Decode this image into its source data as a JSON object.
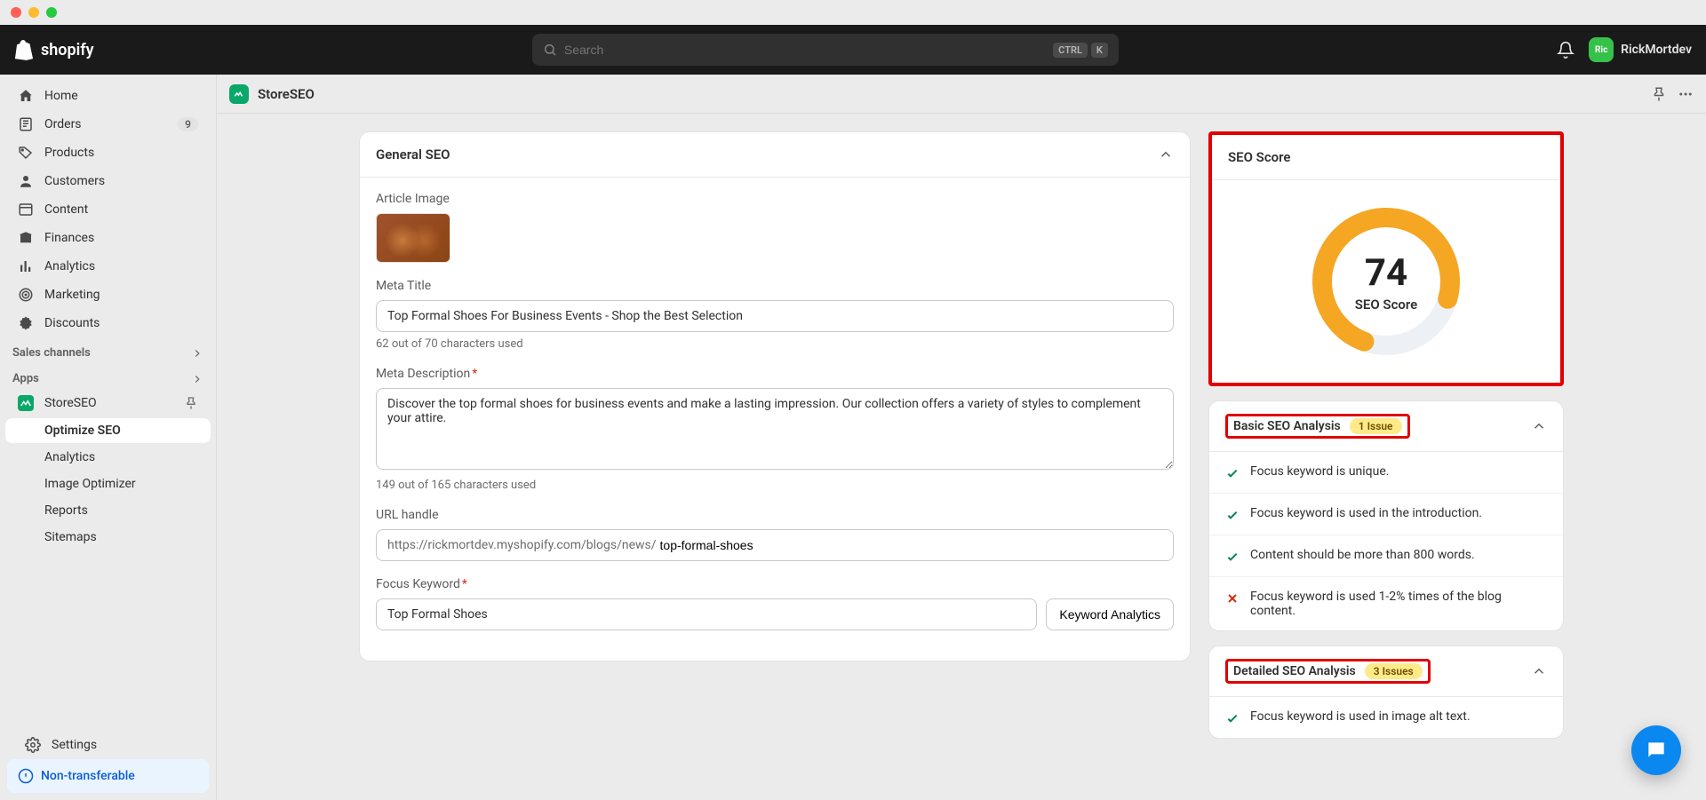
{
  "brand": "shopify",
  "search": {
    "placeholder": "Search",
    "kbd1": "CTRL",
    "kbd2": "K"
  },
  "user": {
    "name": "RickMortdev",
    "initials": "Ric"
  },
  "sidebar": {
    "items": [
      {
        "label": "Home"
      },
      {
        "label": "Orders",
        "badge": "9"
      },
      {
        "label": "Products"
      },
      {
        "label": "Customers"
      },
      {
        "label": "Content"
      },
      {
        "label": "Finances"
      },
      {
        "label": "Analytics"
      },
      {
        "label": "Marketing"
      },
      {
        "label": "Discounts"
      }
    ],
    "sales_channels_label": "Sales channels",
    "apps_label": "Apps",
    "app_name": "StoreSEO",
    "subnav": [
      {
        "label": "Optimize SEO",
        "active": true
      },
      {
        "label": "Analytics"
      },
      {
        "label": "Image Optimizer"
      },
      {
        "label": "Reports"
      },
      {
        "label": "Sitemaps"
      }
    ],
    "settings_label": "Settings",
    "non_transferable_label": "Non-transferable"
  },
  "page": {
    "app_title": "StoreSEO"
  },
  "general_seo": {
    "section_title": "General SEO",
    "article_image_label": "Article Image",
    "meta_title_label": "Meta Title",
    "meta_title_value": "Top Formal Shoes For Business Events - Shop the Best Selection",
    "meta_title_helper": "62 out of 70 characters used",
    "meta_desc_label": "Meta Description",
    "meta_desc_value": "Discover the top formal shoes for business events and make a lasting impression. Our collection offers a variety of styles to complement your attire.",
    "meta_desc_helper": "149 out of 165 characters used",
    "url_handle_label": "URL handle",
    "url_prefix": "https://rickmortdev.myshopify.com/blogs/news/",
    "url_slug": "top-formal-shoes",
    "focus_keyword_label": "Focus Keyword",
    "focus_keyword_value": "Top Formal Shoes",
    "keyword_analytics_btn": "Keyword Analytics"
  },
  "seo_score": {
    "title": "SEO Score",
    "value": "74",
    "label": "SEO Score",
    "ring_color": "#f5a623",
    "track_color": "#edf1f5",
    "percent": 74
  },
  "basic_seo": {
    "title": "Basic SEO Analysis",
    "issues_label": "1 Issue",
    "rows": [
      {
        "ok": true,
        "text": "Focus keyword is unique."
      },
      {
        "ok": true,
        "text": "Focus keyword is used in the introduction."
      },
      {
        "ok": true,
        "text": "Content should be more than 800 words."
      },
      {
        "ok": false,
        "text": "Focus keyword is used 1-2% times of the blog content."
      }
    ]
  },
  "detailed_seo": {
    "title": "Detailed SEO Analysis",
    "issues_label": "3 Issues",
    "rows": [
      {
        "ok": true,
        "text": "Focus keyword is used in image alt text."
      }
    ]
  },
  "chart_data": {
    "type": "gauge",
    "value": 74,
    "min": 0,
    "max": 100,
    "label": "SEO Score",
    "color": "#f5a623"
  }
}
